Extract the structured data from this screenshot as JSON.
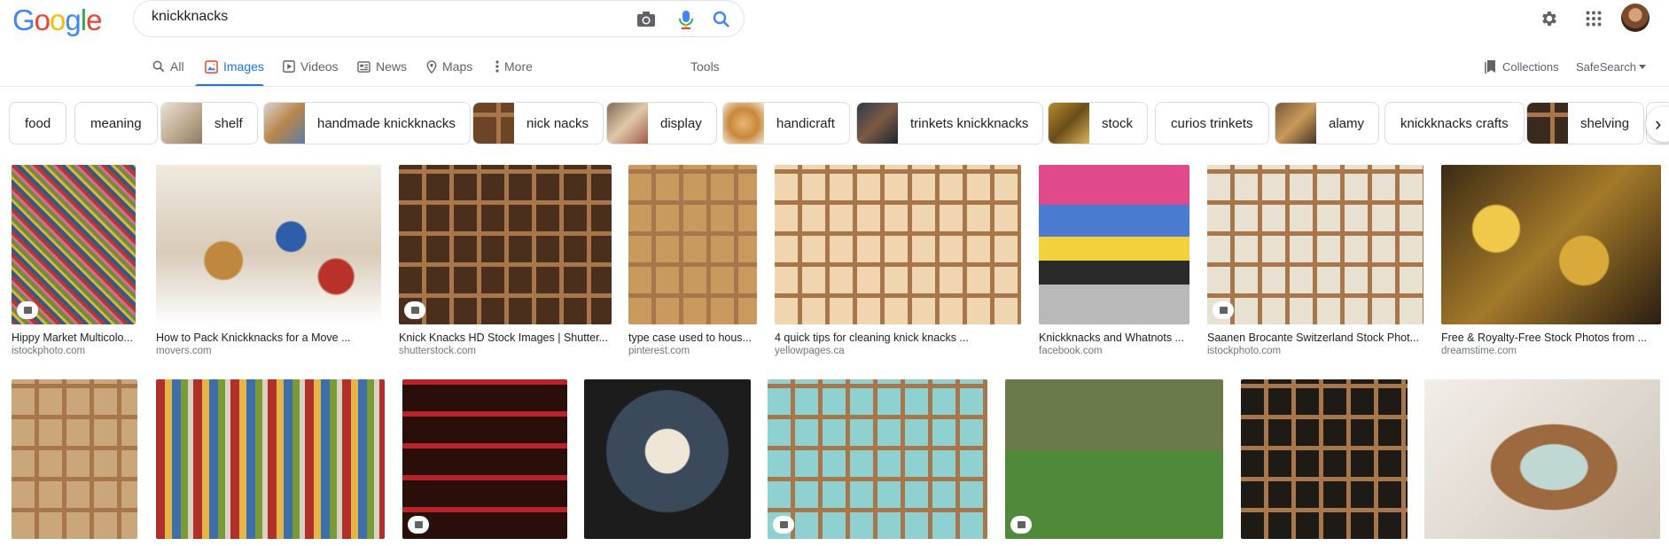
{
  "header": {
    "query": "knickknacks",
    "logo_letters": [
      {
        "ch": "G",
        "color": "#4285f4"
      },
      {
        "ch": "o",
        "color": "#ea4335"
      },
      {
        "ch": "o",
        "color": "#fbbc05"
      },
      {
        "ch": "g",
        "color": "#4285f4"
      },
      {
        "ch": "l",
        "color": "#34a853"
      },
      {
        "ch": "e",
        "color": "#ea4335"
      }
    ],
    "icons": {
      "camera": "camera-icon",
      "mic": "mic-icon",
      "search": "search-icon",
      "settings": "gear-icon",
      "apps": "apps-grid-icon"
    }
  },
  "tabs": [
    {
      "label": "All",
      "icon": "search-icon",
      "active": false
    },
    {
      "label": "Images",
      "icon": "image-icon",
      "active": true
    },
    {
      "label": "Videos",
      "icon": "video-icon",
      "active": false
    },
    {
      "label": "News",
      "icon": "news-icon",
      "active": false
    },
    {
      "label": "Maps",
      "icon": "pin-icon",
      "active": false
    },
    {
      "label": "More",
      "icon": "more-vert-icon",
      "active": false
    }
  ],
  "tools_label": "Tools",
  "collections_label": "Collections",
  "safesearch_label": "SafeSearch",
  "chips": [
    {
      "label": "food"
    },
    {
      "label": "meaning"
    },
    {
      "label": "shelf"
    },
    {
      "label": "handmade knickknacks"
    },
    {
      "label": "nick nacks"
    },
    {
      "label": "display"
    },
    {
      "label": "handicraft"
    },
    {
      "label": "trinkets knickknacks"
    },
    {
      "label": "stock"
    },
    {
      "label": "curios trinkets"
    },
    {
      "label": "alamy"
    },
    {
      "label": "knickknacks crafts"
    },
    {
      "label": "shelving"
    }
  ],
  "results_row1": [
    {
      "caption": "Hippy Market Multicolo...",
      "source": "istockphoto.com",
      "badge": true
    },
    {
      "caption": "How to Pack Knickknacks for a Move ...",
      "source": "movers.com",
      "badge": false
    },
    {
      "caption": "Knick Knacks HD Stock Images | Shutter...",
      "source": "shutterstock.com",
      "badge": true
    },
    {
      "caption": "type case used to hous...",
      "source": "pinterest.com",
      "badge": false
    },
    {
      "caption": "4 quick tips for cleaning knick knacks ...",
      "source": "yellowpages.ca",
      "badge": false
    },
    {
      "caption": "Knickknacks and Whatnots ...",
      "source": "facebook.com",
      "badge": false
    },
    {
      "caption": "Saanen Brocante Switzerland Stock Phot...",
      "source": "istockphoto.com",
      "badge": true
    },
    {
      "caption": "Free & Royalty-Free Stock Photos from ...",
      "source": "dreamstime.com",
      "badge": false
    }
  ],
  "results_row2_badges": [
    false,
    false,
    true,
    false,
    true,
    true,
    false,
    false
  ]
}
